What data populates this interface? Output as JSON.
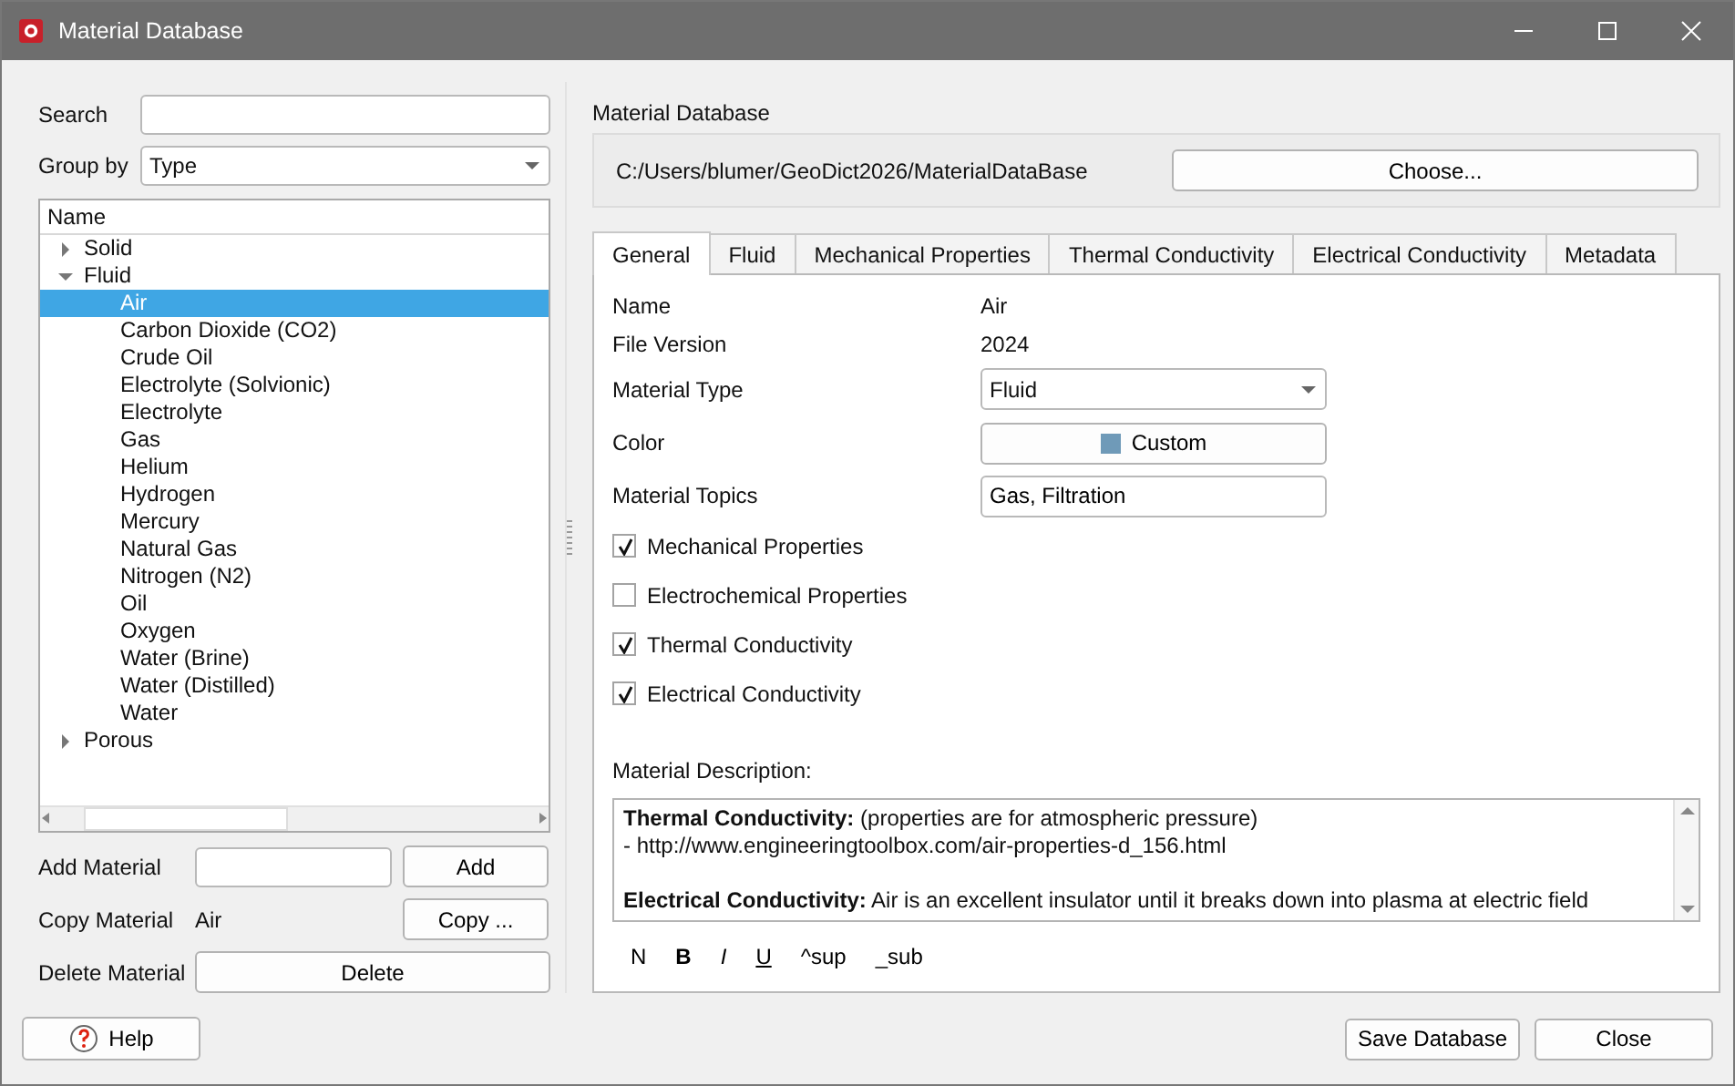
{
  "window": {
    "title": "Material Database"
  },
  "search": {
    "label": "Search"
  },
  "group_by": {
    "label": "Group by",
    "value": "Type"
  },
  "tree": {
    "header": "Name",
    "items": [
      {
        "label": "Solid",
        "expanded": false,
        "selected": false
      },
      {
        "label": "Fluid",
        "expanded": true,
        "selected": false,
        "children": [
          {
            "label": "Air",
            "selected": true
          },
          {
            "label": "Carbon Dioxide (CO2)",
            "selected": false
          },
          {
            "label": "Crude Oil",
            "selected": false
          },
          {
            "label": "Electrolyte (Solvionic)",
            "selected": false
          },
          {
            "label": "Electrolyte",
            "selected": false
          },
          {
            "label": "Gas",
            "selected": false
          },
          {
            "label": "Helium",
            "selected": false
          },
          {
            "label": "Hydrogen",
            "selected": false
          },
          {
            "label": "Mercury",
            "selected": false
          },
          {
            "label": "Natural Gas",
            "selected": false
          },
          {
            "label": "Nitrogen (N2)",
            "selected": false
          },
          {
            "label": "Oil",
            "selected": false
          },
          {
            "label": "Oxygen",
            "selected": false
          },
          {
            "label": "Water (Brine)",
            "selected": false
          },
          {
            "label": "Water (Distilled)",
            "selected": false
          },
          {
            "label": "Water",
            "selected": false
          }
        ]
      },
      {
        "label": "Porous",
        "expanded": false,
        "selected": false
      }
    ]
  },
  "add_material": {
    "label": "Add Material",
    "button": "Add"
  },
  "copy_material": {
    "label": "Copy Material",
    "value": "Air",
    "button": "Copy ..."
  },
  "delete_material": {
    "label": "Delete Material",
    "button": "Delete"
  },
  "help_button": "Help",
  "database": {
    "label": "Material Database",
    "path": "C:/Users/blumer/GeoDict2026/MaterialDataBase",
    "button": "Choose..."
  },
  "tabs": [
    {
      "label": "General",
      "selected": true
    },
    {
      "label": "Fluid",
      "selected": false
    },
    {
      "label": "Mechanical Properties",
      "selected": false
    },
    {
      "label": "Thermal Conductivity",
      "selected": false
    },
    {
      "label": "Electrical Conductivity",
      "selected": false
    },
    {
      "label": "Metadata",
      "selected": false
    }
  ],
  "general": {
    "fields": [
      {
        "kind": "text",
        "label": "Name",
        "value": "Air"
      },
      {
        "kind": "text",
        "label": "File Version",
        "value": "2024"
      },
      {
        "kind": "select",
        "label": "Material Type",
        "value": "Fluid"
      },
      {
        "kind": "color",
        "label": "Color",
        "value": "Custom",
        "color": "#6f9ab8"
      },
      {
        "kind": "input",
        "label": "Material Topics",
        "value": "Gas, Filtration"
      }
    ],
    "checkboxes": [
      {
        "label": "Mechanical Properties",
        "checked": true
      },
      {
        "label": "Electrochemical Properties",
        "checked": false
      },
      {
        "label": "Thermal Conductivity",
        "checked": true
      },
      {
        "label": "Electrical Conductivity",
        "checked": true
      }
    ],
    "description_label": "Material Description:",
    "description": [
      {
        "lines": [
          "**Thermal Conductivity:** (properties are for atmospheric pressure)",
          "- http://www.engineeringtoolbox.com/air-properties-d_156.html"
        ]
      },
      {
        "lines": [
          "**Electrical Conductivity:** Air is an excellent insulator until it breaks down into plasma at electric field"
        ]
      }
    ],
    "format_buttons": [
      {
        "label": "N",
        "kind": "normal"
      },
      {
        "label": "B",
        "kind": "bold"
      },
      {
        "label": "I",
        "kind": "italic"
      },
      {
        "label": "U",
        "kind": "underline"
      },
      {
        "label": "^sup",
        "kind": "plain"
      },
      {
        "label": "_sub",
        "kind": "plain"
      }
    ]
  },
  "footer_buttons": [
    "Save Database",
    "Close"
  ]
}
